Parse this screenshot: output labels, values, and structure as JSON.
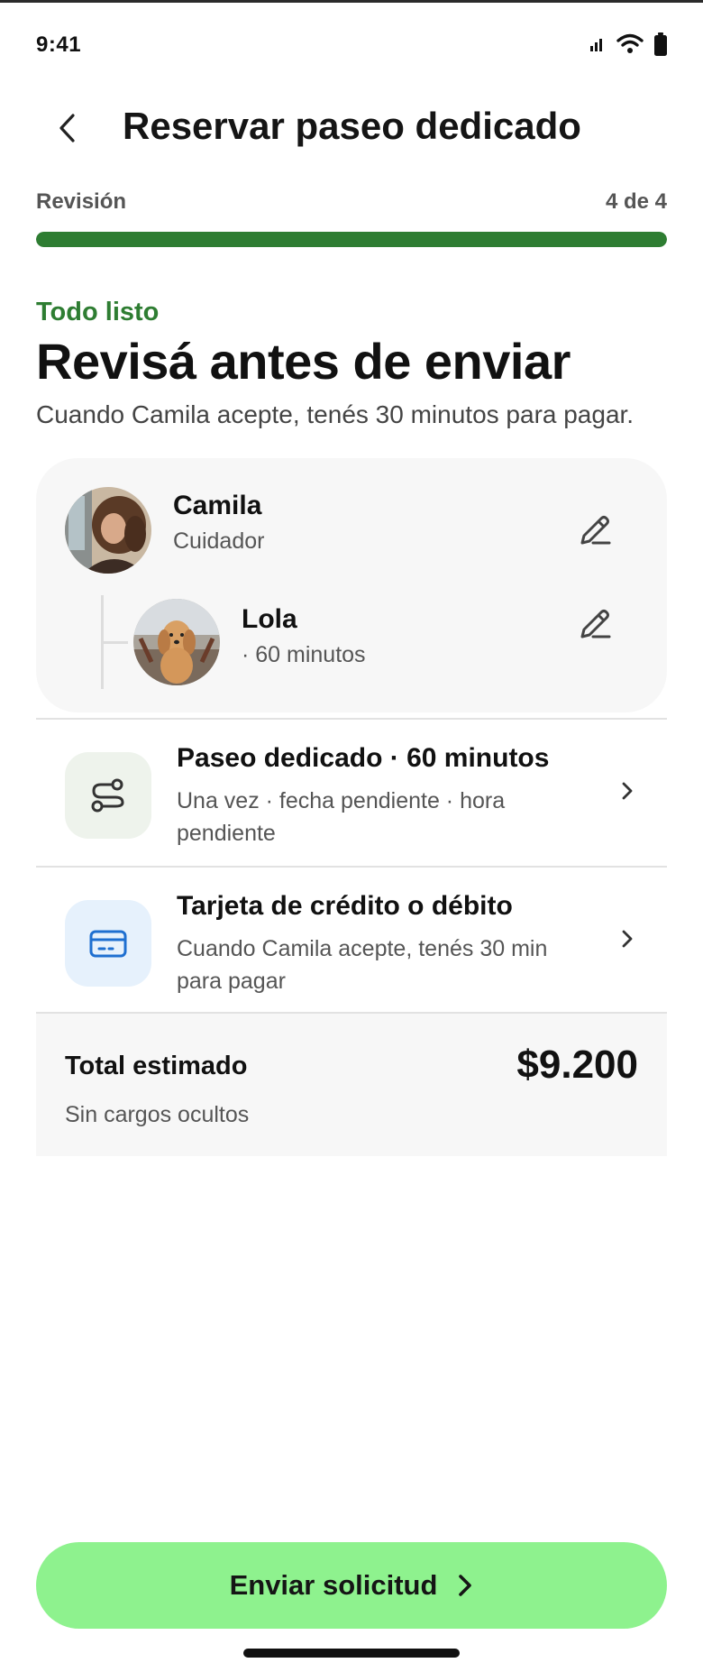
{
  "status_bar": {
    "time": "9:41",
    "icons": [
      "signal-icon",
      "wifi-icon",
      "battery-icon"
    ]
  },
  "header": {
    "title": "Reservar paseo dedicado",
    "back_icon": "chevron-left-icon"
  },
  "progress": {
    "step_label": "Revisión",
    "step_count": "4 de 4",
    "fraction": 1.0
  },
  "intro": {
    "eyebrow": "Todo listo",
    "title": "Revisá antes de enviar",
    "subtitle": "Cuando Camila acepte, tenés 30 minutos para pagar."
  },
  "people": {
    "caregiver": {
      "name": "Camila",
      "role": "Cuidador"
    },
    "pet": {
      "name": "Lola",
      "detail": "· 60 minutos"
    }
  },
  "service": {
    "title": "Paseo dedicado · 60 minutos",
    "subtitle": "Una vez · fecha pendiente · hora pendiente",
    "icon": "route-icon"
  },
  "payment": {
    "title": "Tarjeta de crédito o débito",
    "subtitle": "Cuando Camila acepte, tenés 30 min para pagar",
    "icon": "credit-card-icon"
  },
  "total": {
    "label": "Total estimado",
    "amount": "$9.200",
    "note": "Sin cargos ocultos"
  },
  "submit": {
    "label": "Enviar solicitud"
  },
  "colors": {
    "accent_green": "#2e7d32",
    "button_green": "#8ef28e",
    "service_icon_bg": "#eef3ec",
    "payment_icon_bg": "#e6f1fc",
    "payment_icon_blue": "#1e6fd0"
  }
}
